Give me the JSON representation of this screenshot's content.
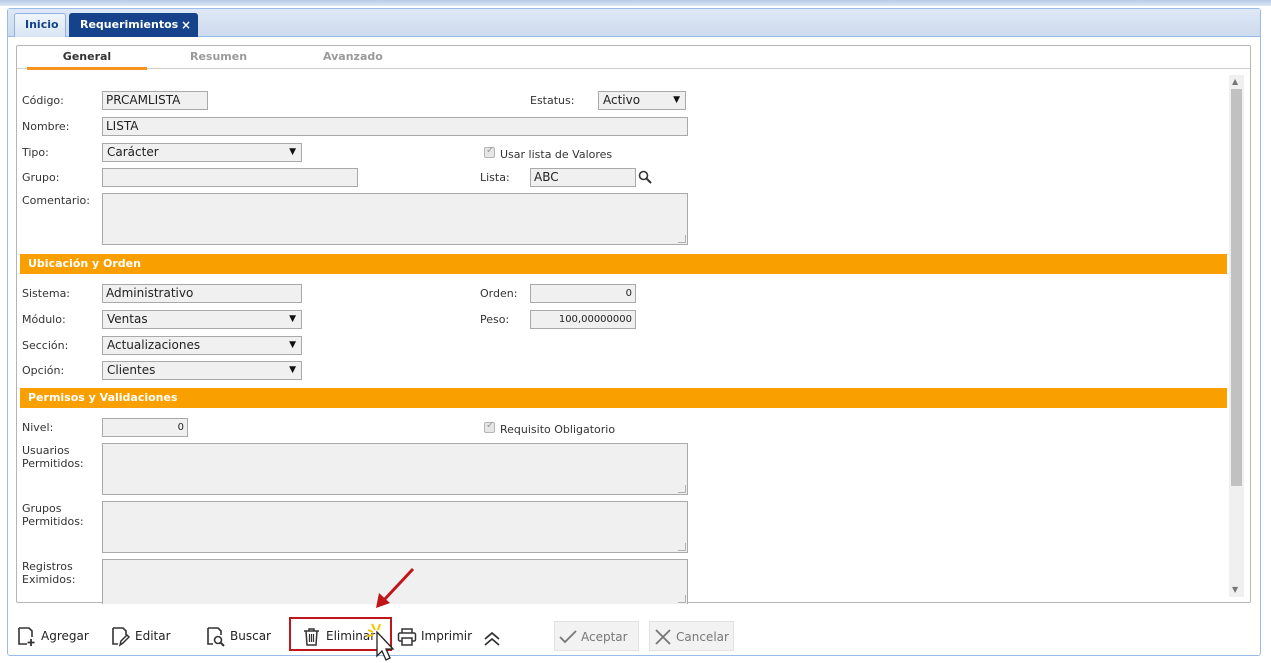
{
  "tabs": {
    "inicio": "Inicio",
    "requerimientos": "Requerimientos",
    "close": "×"
  },
  "subtabs": {
    "general": "General",
    "resumen": "Resumen",
    "avanzado": "Avanzado"
  },
  "general": {
    "codigo_label": "Código:",
    "codigo_value": "PRCAMLISTA",
    "estatus_label": "Estatus:",
    "estatus_value": "Activo",
    "nombre_label": "Nombre:",
    "nombre_value": "LISTA",
    "tipo_label": "Tipo:",
    "tipo_value": "Carácter",
    "usar_lista_label": "Usar lista de Valores",
    "grupo_label": "Grupo:",
    "grupo_value": "",
    "lista_label": "Lista:",
    "lista_value": "ABC",
    "comentario_label": "Comentario:"
  },
  "ubicacion": {
    "title": "Ubicación y Orden",
    "sistema_label": "Sistema:",
    "sistema_value": "Administrativo",
    "orden_label": "Orden:",
    "orden_value": "0",
    "modulo_label": "Módulo:",
    "modulo_value": "Ventas",
    "peso_label": "Peso:",
    "peso_value": "100,00000000",
    "seccion_label": "Sección:",
    "seccion_value": "Actualizaciones",
    "opcion_label": "Opción:",
    "opcion_value": "Clientes"
  },
  "permisos": {
    "title": "Permisos y Validaciones",
    "nivel_label": "Nivel:",
    "nivel_value": "0",
    "requisito_label": "Requisito Obligatorio",
    "usuarios_label_1": "Usuarios",
    "usuarios_label_2": "Permitidos:",
    "grupos_label_1": "Grupos",
    "grupos_label_2": "Permitidos:",
    "registros_label_1": "Registros",
    "registros_label_2": "Eximidos:"
  },
  "toolbar": {
    "agregar": "Agregar",
    "editar": "Editar",
    "buscar": "Buscar",
    "eliminar": "Eliminar",
    "imprimir": "Imprimir",
    "aceptar": "Aceptar",
    "cancelar": "Cancelar"
  },
  "colors": {
    "section_orange": "#f9a000",
    "tab_active": "#15428b",
    "highlight_red": "#c0151b"
  },
  "icons": [
    "close-icon",
    "dropdown-caret-icon",
    "checkbox-icon",
    "search-icon",
    "add-document-icon",
    "edit-document-icon",
    "search-document-icon",
    "trash-icon",
    "printer-icon",
    "double-chevron-up-icon",
    "checkmark-icon",
    "x-icon",
    "red-arrow-annotation",
    "mouse-cursor-icon"
  ]
}
